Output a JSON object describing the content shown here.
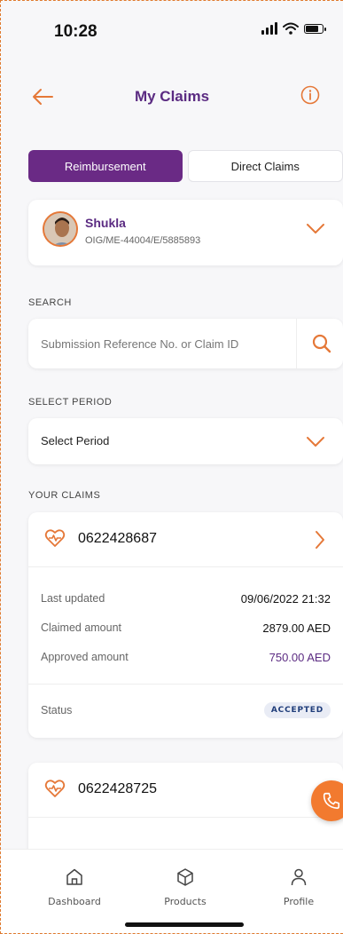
{
  "status_bar": {
    "time": "10:28"
  },
  "header": {
    "title": "My Claims"
  },
  "tabs": [
    {
      "label": "Reimbursement",
      "active": true
    },
    {
      "label": "Direct Claims",
      "active": false
    }
  ],
  "member": {
    "name": "Shukla",
    "policy_id": "OIG/ME-44004/E/5885893"
  },
  "search": {
    "section_label": "SEARCH",
    "placeholder": "Submission Reference No. or Claim ID"
  },
  "period": {
    "section_label": "SELECT PERIOD",
    "value": "Select Period"
  },
  "claims_section_label": "YOUR CLAIMS",
  "claims": [
    {
      "claim_id": "0622428687",
      "last_updated_label": "Last updated",
      "last_updated": "09/06/2022 21:32",
      "claimed_label": "Claimed amount",
      "claimed": "2879.00 AED",
      "approved_label": "Approved amount",
      "approved": "750.00 AED",
      "status_label": "Status",
      "status": "ACCEPTED"
    },
    {
      "claim_id": "0622428725"
    }
  ],
  "bottom_nav": [
    {
      "label": "Dashboard",
      "icon": "home-icon"
    },
    {
      "label": "Products",
      "icon": "cube-icon"
    },
    {
      "label": "Profile",
      "icon": "person-icon"
    }
  ],
  "colors": {
    "brand_purple": "#6a2a85",
    "accent_orange": "#f27a2f",
    "status_badge_bg": "#e9ecf5"
  }
}
